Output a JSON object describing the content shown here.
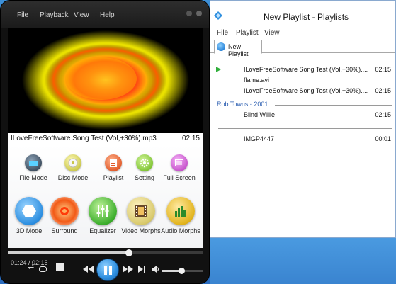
{
  "player": {
    "menu": [
      "File",
      "Playback",
      "View",
      "Help"
    ],
    "now_playing": {
      "title": "ILoveFreeSoftware Song Test (Vol,+30%).mp3",
      "duration": "02:15"
    },
    "mode_buttons": [
      {
        "label": "File Mode",
        "icon": "folder-icon",
        "color": "#3b4b5c"
      },
      {
        "label": "Disc Mode",
        "icon": "disc-icon",
        "color": "#c9c64a"
      },
      {
        "label": "Playlist",
        "icon": "playlist-icon",
        "color": "#e05a2a"
      },
      {
        "label": "Setting",
        "icon": "gear-icon",
        "color": "#7ec332"
      },
      {
        "label": "Full Screen",
        "icon": "fullscreen-icon",
        "color": "#c44fc9"
      }
    ],
    "effect_buttons": [
      {
        "label": "3D Mode",
        "icon": "3d-icon",
        "color": "#2c8ee0"
      },
      {
        "label": "Surround",
        "icon": "surround-icon",
        "color": "#f25a16"
      },
      {
        "label": "Equalizer",
        "icon": "equalizer-icon",
        "color": "#3cae2c"
      },
      {
        "label": "Video Morphs",
        "icon": "film-icon",
        "color": "#d8c96c"
      },
      {
        "label": "Audio Morphs",
        "icon": "bars-icon",
        "color": "#e2b41e"
      }
    ],
    "time": "01:24 / 02:15",
    "seek_progress": 0.62,
    "volume": 0.46
  },
  "playlist_window": {
    "title": "New Playlist - Playlists",
    "menu": [
      "File",
      "Playlist",
      "View"
    ],
    "tab": "New Playlist",
    "items": [
      {
        "title": "ILoveFreeSoftware Song Test (Vol,+30%)....",
        "duration": "02:15",
        "playing": true
      },
      {
        "title": "flame.avi",
        "duration": "",
        "playing": false
      },
      {
        "title": "ILoveFreeSoftware Song Test (Vol,+30%)....",
        "duration": "02:15",
        "playing": false
      }
    ],
    "group_header": "Rob Towns - 2001",
    "group_items": [
      {
        "title": "Blind Willie",
        "duration": "02:15"
      }
    ],
    "other_items": [
      {
        "title": "IMGP4447",
        "duration": "00:01"
      }
    ]
  }
}
